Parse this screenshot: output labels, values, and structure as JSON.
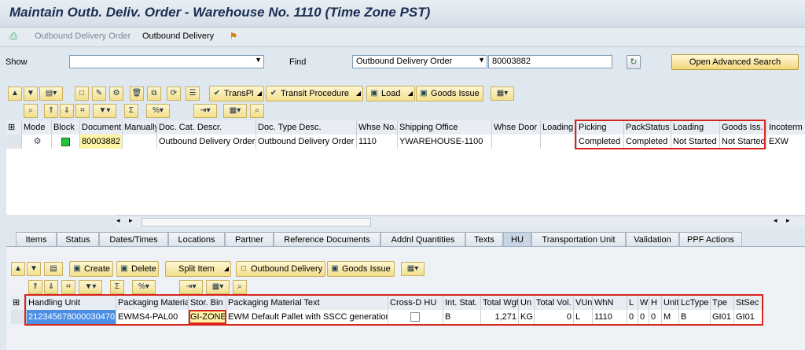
{
  "window": {
    "title": "Maintain Outb. Deliv. Order - Warehouse No. 1110 (Time Zone PST)"
  },
  "appbar": {
    "link1": "Outbound Delivery Order",
    "link2": "Outbound Delivery"
  },
  "search": {
    "show_label": "Show",
    "show_value": "",
    "find_label": "Find",
    "find_type": "Outbound Delivery Order",
    "find_value": "80003882",
    "advanced_button": "Open Advanced Search"
  },
  "toolbar1": {
    "transpl": "TransPl",
    "transit": "Transit Procedure",
    "load": "Load",
    "goods_issue": "Goods Issue"
  },
  "header_grid": {
    "columns": [
      "Mode",
      "Block",
      "Document",
      "Manually",
      "Doc. Cat. Descr.",
      "Doc. Type Desc.",
      "Whse No.",
      "Shipping Office",
      "Whse Door",
      "Loading Pt",
      "Picking",
      "PackStatus",
      "Loading",
      "Goods Iss.",
      "Incoterm"
    ],
    "row": [
      "",
      "",
      "80003882",
      "",
      "Outbound Delivery Order",
      "Outbound Delivery Order",
      "1110",
      "YWAREHOUSE-1100",
      "",
      "",
      "Completed",
      "Completed",
      "Not Started",
      "Not Started",
      "EXW"
    ],
    "block_color": "#21c43a"
  },
  "tabs": [
    "Items",
    "Status",
    "Dates/Times",
    "Locations",
    "Partner",
    "Reference Documents",
    "Addnl Quantities",
    "Texts",
    "HU",
    "Transportation Unit",
    "Validation",
    "PPF Actions"
  ],
  "active_tab": "HU",
  "toolbar2": {
    "create": "Create",
    "delete": "Delete",
    "split": "Split Item",
    "outbound": "Outbound Delivery",
    "goods_issue": "Goods Issue"
  },
  "hu_grid": {
    "columns": [
      "Handling Unit",
      "Packaging Material",
      "Stor. Bin",
      "Packaging Material Text",
      "Cross-D HU",
      "Int. Stat.",
      "Total Wght",
      "Un",
      "Total Vol.",
      "VUn",
      "WhN",
      "L",
      "W",
      "H",
      "Unit",
      "LcType",
      "Tpe",
      "StSec"
    ],
    "row": [
      "212345678000030470",
      "EWMS4-PAL00",
      "GI-ZONE",
      "EWM Default Pallet with SSCC generation",
      "",
      "B",
      "1,271",
      "KG",
      "0",
      "L",
      "1110",
      "0",
      "0",
      "0",
      "M",
      "B",
      "GI01",
      "GI01"
    ]
  },
  "colors": {
    "highlight": "#d9241c",
    "doc_field": "#fff3a6"
  }
}
